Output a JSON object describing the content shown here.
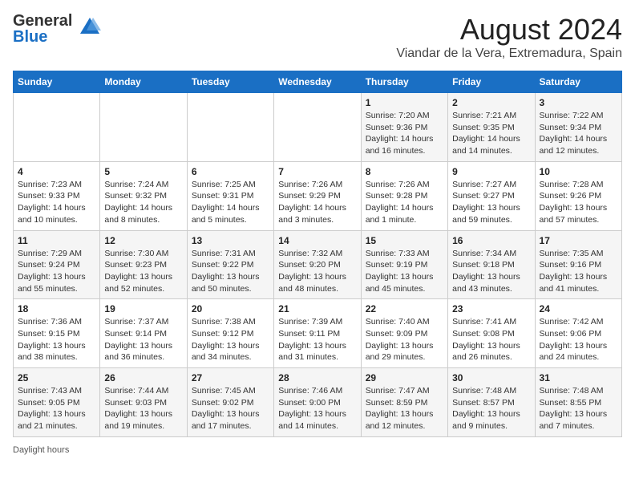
{
  "header": {
    "logo_line1": "General",
    "logo_line2": "Blue",
    "title": "August 2024",
    "subtitle": "Viandar de la Vera, Extremadura, Spain"
  },
  "weekdays": [
    "Sunday",
    "Monday",
    "Tuesday",
    "Wednesday",
    "Thursday",
    "Friday",
    "Saturday"
  ],
  "weeks": [
    [
      {
        "day": "",
        "info": ""
      },
      {
        "day": "",
        "info": ""
      },
      {
        "day": "",
        "info": ""
      },
      {
        "day": "",
        "info": ""
      },
      {
        "day": "1",
        "info": "Sunrise: 7:20 AM\nSunset: 9:36 PM\nDaylight: 14 hours and 16 minutes."
      },
      {
        "day": "2",
        "info": "Sunrise: 7:21 AM\nSunset: 9:35 PM\nDaylight: 14 hours and 14 minutes."
      },
      {
        "day": "3",
        "info": "Sunrise: 7:22 AM\nSunset: 9:34 PM\nDaylight: 14 hours and 12 minutes."
      }
    ],
    [
      {
        "day": "4",
        "info": "Sunrise: 7:23 AM\nSunset: 9:33 PM\nDaylight: 14 hours and 10 minutes."
      },
      {
        "day": "5",
        "info": "Sunrise: 7:24 AM\nSunset: 9:32 PM\nDaylight: 14 hours and 8 minutes."
      },
      {
        "day": "6",
        "info": "Sunrise: 7:25 AM\nSunset: 9:31 PM\nDaylight: 14 hours and 5 minutes."
      },
      {
        "day": "7",
        "info": "Sunrise: 7:26 AM\nSunset: 9:29 PM\nDaylight: 14 hours and 3 minutes."
      },
      {
        "day": "8",
        "info": "Sunrise: 7:26 AM\nSunset: 9:28 PM\nDaylight: 14 hours and 1 minute."
      },
      {
        "day": "9",
        "info": "Sunrise: 7:27 AM\nSunset: 9:27 PM\nDaylight: 13 hours and 59 minutes."
      },
      {
        "day": "10",
        "info": "Sunrise: 7:28 AM\nSunset: 9:26 PM\nDaylight: 13 hours and 57 minutes."
      }
    ],
    [
      {
        "day": "11",
        "info": "Sunrise: 7:29 AM\nSunset: 9:24 PM\nDaylight: 13 hours and 55 minutes."
      },
      {
        "day": "12",
        "info": "Sunrise: 7:30 AM\nSunset: 9:23 PM\nDaylight: 13 hours and 52 minutes."
      },
      {
        "day": "13",
        "info": "Sunrise: 7:31 AM\nSunset: 9:22 PM\nDaylight: 13 hours and 50 minutes."
      },
      {
        "day": "14",
        "info": "Sunrise: 7:32 AM\nSunset: 9:20 PM\nDaylight: 13 hours and 48 minutes."
      },
      {
        "day": "15",
        "info": "Sunrise: 7:33 AM\nSunset: 9:19 PM\nDaylight: 13 hours and 45 minutes."
      },
      {
        "day": "16",
        "info": "Sunrise: 7:34 AM\nSunset: 9:18 PM\nDaylight: 13 hours and 43 minutes."
      },
      {
        "day": "17",
        "info": "Sunrise: 7:35 AM\nSunset: 9:16 PM\nDaylight: 13 hours and 41 minutes."
      }
    ],
    [
      {
        "day": "18",
        "info": "Sunrise: 7:36 AM\nSunset: 9:15 PM\nDaylight: 13 hours and 38 minutes."
      },
      {
        "day": "19",
        "info": "Sunrise: 7:37 AM\nSunset: 9:14 PM\nDaylight: 13 hours and 36 minutes."
      },
      {
        "day": "20",
        "info": "Sunrise: 7:38 AM\nSunset: 9:12 PM\nDaylight: 13 hours and 34 minutes."
      },
      {
        "day": "21",
        "info": "Sunrise: 7:39 AM\nSunset: 9:11 PM\nDaylight: 13 hours and 31 minutes."
      },
      {
        "day": "22",
        "info": "Sunrise: 7:40 AM\nSunset: 9:09 PM\nDaylight: 13 hours and 29 minutes."
      },
      {
        "day": "23",
        "info": "Sunrise: 7:41 AM\nSunset: 9:08 PM\nDaylight: 13 hours and 26 minutes."
      },
      {
        "day": "24",
        "info": "Sunrise: 7:42 AM\nSunset: 9:06 PM\nDaylight: 13 hours and 24 minutes."
      }
    ],
    [
      {
        "day": "25",
        "info": "Sunrise: 7:43 AM\nSunset: 9:05 PM\nDaylight: 13 hours and 21 minutes."
      },
      {
        "day": "26",
        "info": "Sunrise: 7:44 AM\nSunset: 9:03 PM\nDaylight: 13 hours and 19 minutes."
      },
      {
        "day": "27",
        "info": "Sunrise: 7:45 AM\nSunset: 9:02 PM\nDaylight: 13 hours and 17 minutes."
      },
      {
        "day": "28",
        "info": "Sunrise: 7:46 AM\nSunset: 9:00 PM\nDaylight: 13 hours and 14 minutes."
      },
      {
        "day": "29",
        "info": "Sunrise: 7:47 AM\nSunset: 8:59 PM\nDaylight: 13 hours and 12 minutes."
      },
      {
        "day": "30",
        "info": "Sunrise: 7:48 AM\nSunset: 8:57 PM\nDaylight: 13 hours and 9 minutes."
      },
      {
        "day": "31",
        "info": "Sunrise: 7:48 AM\nSunset: 8:55 PM\nDaylight: 13 hours and 7 minutes."
      }
    ]
  ],
  "footer": {
    "daylight_label": "Daylight hours"
  }
}
